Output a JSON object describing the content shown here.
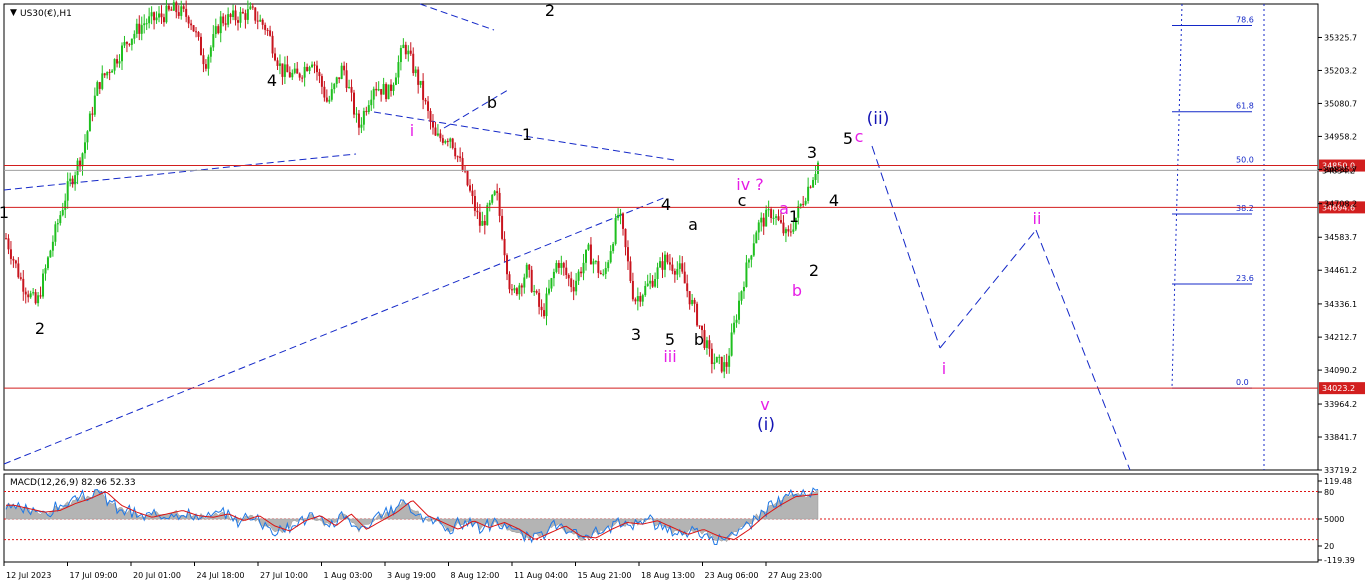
{
  "window": {
    "symbol_label": "US30(€),H1"
  },
  "colors": {
    "bull": "#1fbf1f",
    "bear": "#c8141e",
    "hline": "#d21e1e",
    "projection": "#1428c8",
    "wave_black": "#000000",
    "wave_magenta": "#e61ee6",
    "wave_blue": "#1414b4",
    "macd_hist": "#b4b4b4",
    "macd_line": "#1e78e6",
    "macd_signal": "#dc1414"
  },
  "price_axis": {
    "ylim": [
      33719.2,
      35450
    ],
    "ticks": [
      "35325.7",
      "35203.2",
      "35080.7",
      "34958.2",
      "34835.7",
      "34708.2",
      "34583.7",
      "34461.2",
      "34336.1",
      "34212.7",
      "34090.2",
      "33964.2",
      "33841.7",
      "33719.2"
    ],
    "badges": [
      {
        "name": "level-34850",
        "label": "34850.0",
        "value": 34850.0
      },
      {
        "name": "level-34694",
        "label": "34694.6",
        "value": 34694.6
      },
      {
        "name": "level-34023",
        "label": "34023.2",
        "value": 34023.2
      }
    ],
    "current_price_label": "34834.2",
    "current_price": 34832
  },
  "time_axis": {
    "labels": [
      "12 Jul 2023",
      "17 Jul 09:00",
      "20 Jul 01:00",
      "24 Jul 18:00",
      "27 Jul 10:00",
      "1 Aug 03:00",
      "3 Aug 19:00",
      "8 Aug 12:00",
      "11 Aug 04:00",
      "15 Aug 21:00",
      "18 Aug 13:00",
      "23 Aug 06:00",
      "27 Aug 23:00"
    ]
  },
  "fibonacci": {
    "levels": [
      {
        "label": "78.6",
        "value": 35370
      },
      {
        "label": "61.8",
        "value": 35050
      },
      {
        "label": "50.0",
        "value": 34850
      },
      {
        "label": "38.2",
        "value": 34670
      },
      {
        "label": "23.6",
        "value": 34410
      },
      {
        "label": "0.0",
        "value": 34023.2
      }
    ]
  },
  "wave_labels": {
    "black": [
      "2",
      "4",
      "2",
      "b",
      "1",
      "4",
      "a",
      "c",
      "3",
      "5",
      "b",
      "1",
      "2",
      "3",
      "4",
      "5",
      "1"
    ],
    "magenta": [
      "i",
      "iii",
      "iv ?",
      "a",
      "b",
      "v",
      "c",
      "i",
      "ii"
    ],
    "blue": [
      "(i)",
      "(ii)"
    ]
  },
  "macd": {
    "title": "MACD(12,26,9) 82.96 52.33",
    "ticks": [
      "119.48",
      "80",
      "5000",
      "20",
      "-119.39"
    ],
    "ylim": [
      -119.39,
      119.48
    ],
    "zero": 0,
    "dashed_levels": [
      80,
      0,
      -60
    ]
  },
  "chart_data": {
    "type": "candlestick",
    "title": "US30(€),H1",
    "xlabel": "",
    "ylabel": "",
    "ylim": [
      33719.2,
      35450
    ],
    "grid": false,
    "horizontal_levels": [
      34850.0,
      34694.6,
      34023.2
    ],
    "close_path": [
      34580,
      34420,
      34330,
      34560,
      34760,
      34900,
      35150,
      35230,
      35320,
      35380,
      35400,
      35430,
      35400,
      35230,
      35390,
      35400,
      35420,
      35360,
      35200,
      35180,
      35250,
      35080,
      35220,
      34990,
      35150,
      35120,
      35300,
      35150,
      34950,
      34960,
      34800,
      34620,
      34750,
      34360,
      34460,
      34290,
      34500,
      34400,
      34530,
      34430,
      34680,
      34350,
      34410,
      34500,
      34460,
      34300,
      34130,
      34100,
      34390,
      34620,
      34680,
      34580,
      34720,
      34860
    ],
    "macd_hist_path": [
      40,
      30,
      20,
      25,
      45,
      60,
      80,
      40,
      20,
      5,
      15,
      25,
      10,
      5,
      15,
      -5,
      10,
      -20,
      -35,
      -5,
      10,
      -20,
      15,
      -30,
      -5,
      20,
      55,
      10,
      -10,
      -30,
      -5,
      -25,
      -10,
      -30,
      -60,
      -40,
      -20,
      -50,
      -55,
      -30,
      -10,
      -15,
      -5,
      -25,
      -45,
      -30,
      -50,
      -60,
      -30,
      10,
      40,
      65,
      70,
      75
    ],
    "series": [
      {
        "name": "MACD(12,26,9)",
        "last_value": 82.96
      },
      {
        "name": "",
        "last_value": 52.33
      }
    ]
  }
}
